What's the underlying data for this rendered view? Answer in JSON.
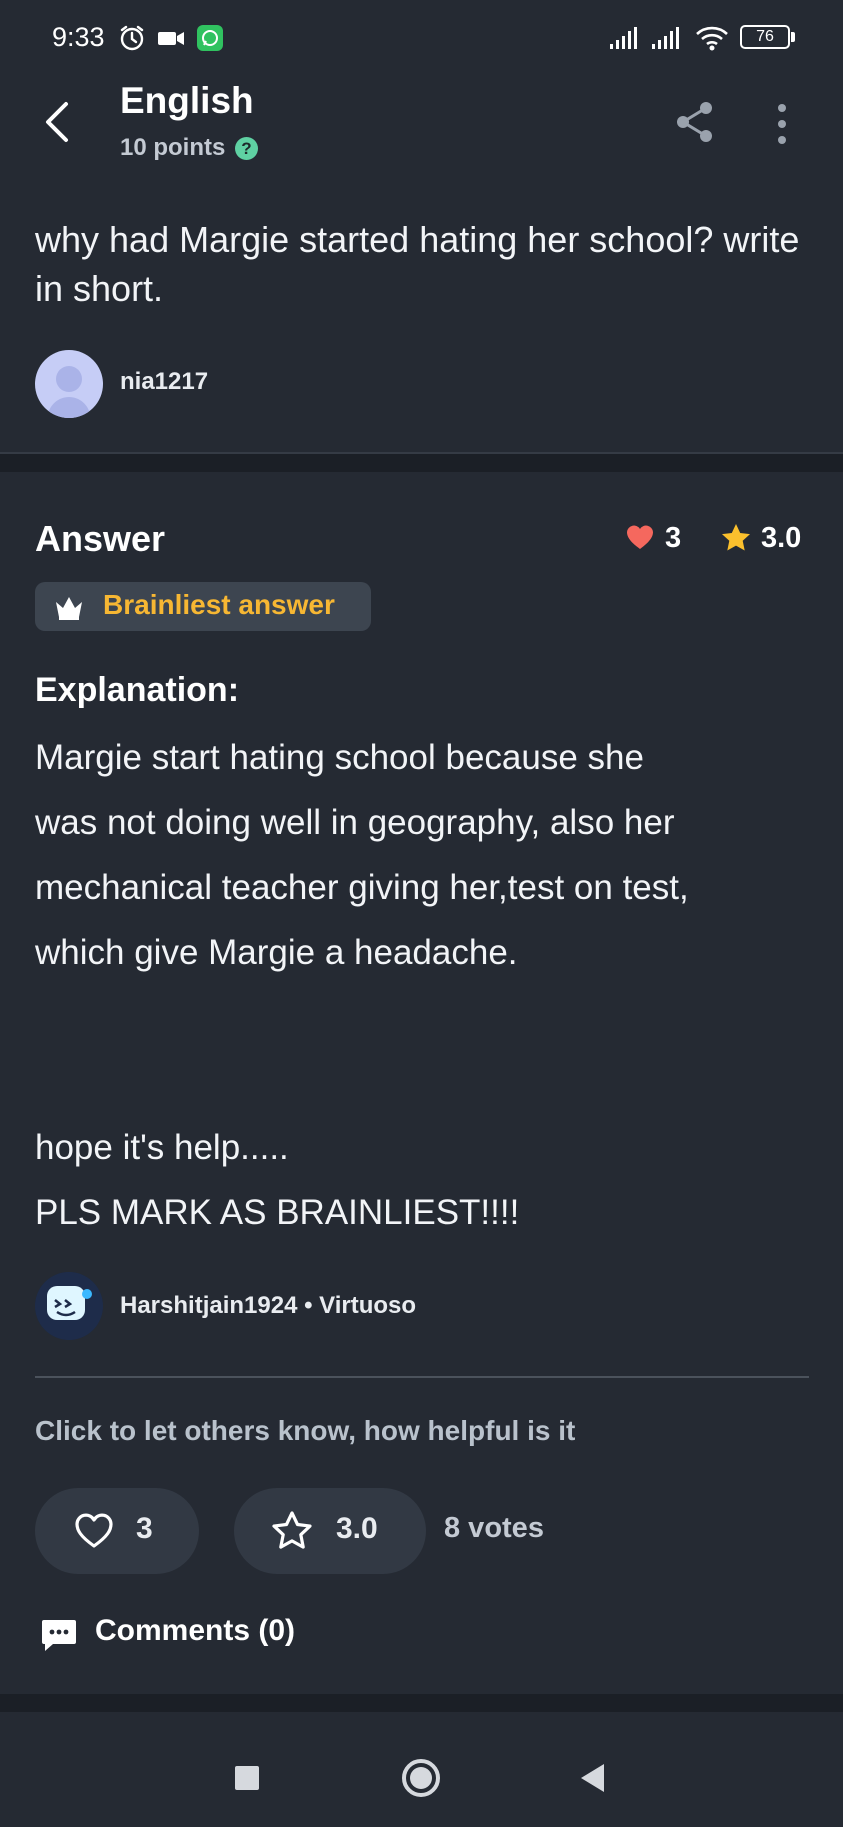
{
  "status_bar": {
    "time": "9:33",
    "battery": "76"
  },
  "header": {
    "subject": "English",
    "points": "10 points",
    "help_icon": "?"
  },
  "question": {
    "text": "why had Margie started hating her school? write in short.",
    "asker": "nia1217"
  },
  "answer": {
    "heading": "Answer",
    "hearts": "3",
    "rating": "3.0",
    "badge": "Brainliest answer",
    "explanation_heading": "Explanation:",
    "lines": [
      "Margie start hating school because she",
      "was not doing well in geography, also her",
      "mechanical teacher giving her,test on test,",
      "which give Margie a headache.",
      "hope it's help.....",
      "PLS MARK AS BRAINLIEST!!!!"
    ],
    "author": "Harshitjain1924 • Virtuoso"
  },
  "feedback": {
    "prompt": "Click to let others know, how helpful is it",
    "like_count": "3",
    "rating_value": "3.0",
    "votes": "8 votes"
  },
  "comments": {
    "label": "Comments (0)"
  },
  "colors": {
    "background": "#252a33",
    "brainliest_gold": "#f7b733",
    "heart_red": "#f5685e",
    "star_yellow": "#fbc02d",
    "help_green": "#5fd1a3"
  }
}
